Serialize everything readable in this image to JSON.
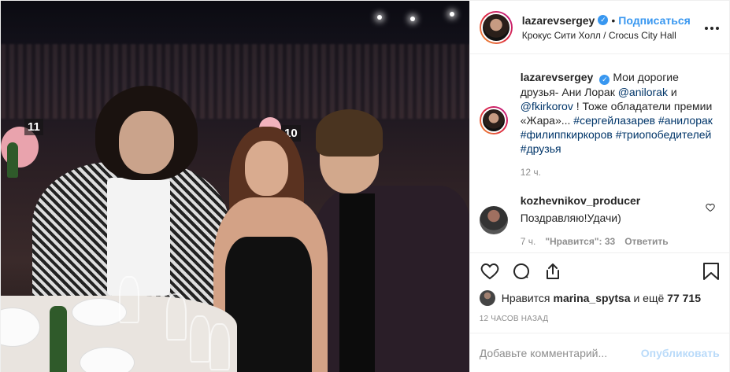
{
  "header": {
    "username": "lazarevsergey",
    "follow_label": "Подписаться",
    "dot": "•",
    "location": "Крокус Сити Холл / Crocus City Hall",
    "more_icon": "more-horizontal-icon"
  },
  "photo": {
    "table_numbers": [
      "11",
      "10"
    ]
  },
  "caption": {
    "username": "lazarevsergey",
    "text_1": "Мои дорогие друзья- Ани Лорак ",
    "mention_1": "@anilorak",
    "text_2": " и ",
    "mention_2": "@fkirkorov",
    "text_3": " ! Тоже обладатели премии «Жара»... ",
    "hashtags": [
      "#сергейлазарев",
      "#анилорак",
      "#филиппкиркоров",
      "#триопобедителей",
      "#друзья"
    ],
    "time": "12 ч."
  },
  "comment": {
    "username": "kozhevnikov_producer",
    "text": "Поздравляю!Удачи)",
    "time": "7 ч.",
    "likes": "\"Нравится\": 33",
    "reply": "Ответить"
  },
  "actions": {
    "likes_prefix": "Нравится ",
    "liker": "marina_spytsa",
    "likes_suffix": " и ещё ",
    "likes_count": "77 715",
    "timestamp": "12 ЧАСОВ НАЗАД"
  },
  "add_comment": {
    "placeholder": "Добавьте комментарий...",
    "publish_label": "Опубликовать"
  },
  "colors": {
    "accent": "#3897f0",
    "text": "#262626",
    "muted": "#8e8e8e",
    "link": "#003569"
  }
}
